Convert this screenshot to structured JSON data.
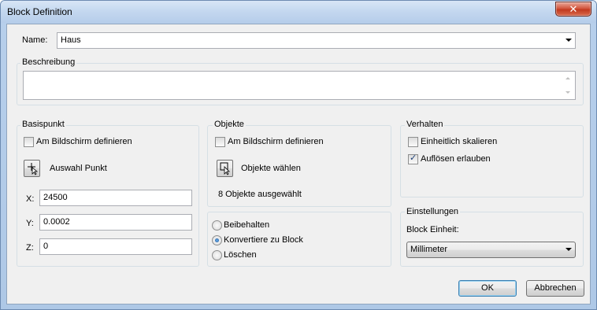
{
  "window": {
    "title": "Block Definition",
    "close_glyph": "✕"
  },
  "name_row": {
    "label": "Name:",
    "value": "Haus"
  },
  "description": {
    "label": "Beschreibung",
    "value": ""
  },
  "basepoint": {
    "label": "Basispunkt",
    "on_screen_label": "Am Bildschirm definieren",
    "on_screen_checked": false,
    "pick_label": "Auswahl Punkt",
    "x_label": "X:",
    "x_value": "24500",
    "y_label": "Y:",
    "y_value": "0.0002",
    "z_label": "Z:",
    "z_value": "0"
  },
  "objects": {
    "label": "Objekte",
    "on_screen_label": "Am Bildschirm definieren",
    "on_screen_checked": false,
    "select_label": "Objekte wählen",
    "count_text": "8 Objekte ausgewählt",
    "options": [
      {
        "label": "Beibehalten",
        "checked": false
      },
      {
        "label": "Konvertiere zu Block",
        "checked": true
      },
      {
        "label": "Löschen",
        "checked": false
      }
    ]
  },
  "behavior": {
    "label": "Verhalten",
    "uniform_scale_label": "Einheitlich skalieren",
    "uniform_scale_checked": false,
    "allow_explode_label": "Auflösen erlauben",
    "allow_explode_checked": true
  },
  "settings": {
    "label": "Einstellungen",
    "unit_label": "Block Einheit:",
    "unit_value": "Millimeter"
  },
  "buttons": {
    "ok": "OK",
    "cancel": "Abbrechen"
  },
  "colors": {
    "title_bar": "#c3d7ef",
    "close_button": "#c23a1f",
    "client_bg": "#f0f0f0",
    "default_button_border": "#3c7fb1"
  }
}
